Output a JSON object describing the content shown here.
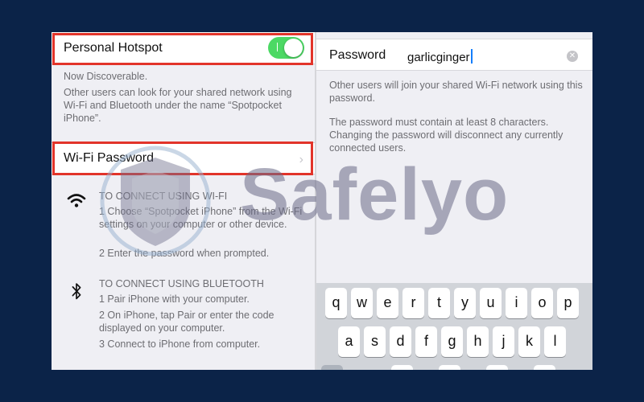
{
  "left": {
    "hotspot_label": "Personal Hotspot",
    "toggle_on": true,
    "discoverable": "Now Discoverable.",
    "discover_note": "Other users can look for your shared network using Wi-Fi and Bluetooth under the name “Spotpocket iPhone”.",
    "wifi_password_label": "Wi-Fi Password",
    "wifi_section": {
      "heading": "TO CONNECT USING WI-FI",
      "steps": [
        "1 Choose “Spotpocket iPhone” from the Wi-Fi settings on your computer or other device.",
        "2 Enter the password when prompted."
      ]
    },
    "bt_section": {
      "heading": "TO CONNECT USING BLUETOOTH",
      "steps": [
        "1 Pair iPhone with your computer.",
        "2 On iPhone, tap Pair or enter the code displayed on your computer.",
        "3 Connect to iPhone from computer."
      ]
    }
  },
  "right": {
    "password_label": "Password",
    "password_value": "garlicginger",
    "note1": "Other users will join your shared Wi-Fi network using this password.",
    "note2": "The password must contain at least 8 characters. Changing the password will disconnect any currently connected users."
  },
  "keyboard": {
    "row1": [
      "q",
      "w",
      "e",
      "r",
      "t",
      "y",
      "u",
      "i",
      "o",
      "p"
    ],
    "row2": [
      "a",
      "s",
      "d",
      "f",
      "g",
      "h",
      "j",
      "k",
      "l"
    ]
  },
  "watermark": {
    "text": "Safelyo"
  },
  "colors": {
    "background": "#0b2348",
    "highlight": "#e2342a",
    "toggle": "#4cd964",
    "caret": "#147efb"
  }
}
